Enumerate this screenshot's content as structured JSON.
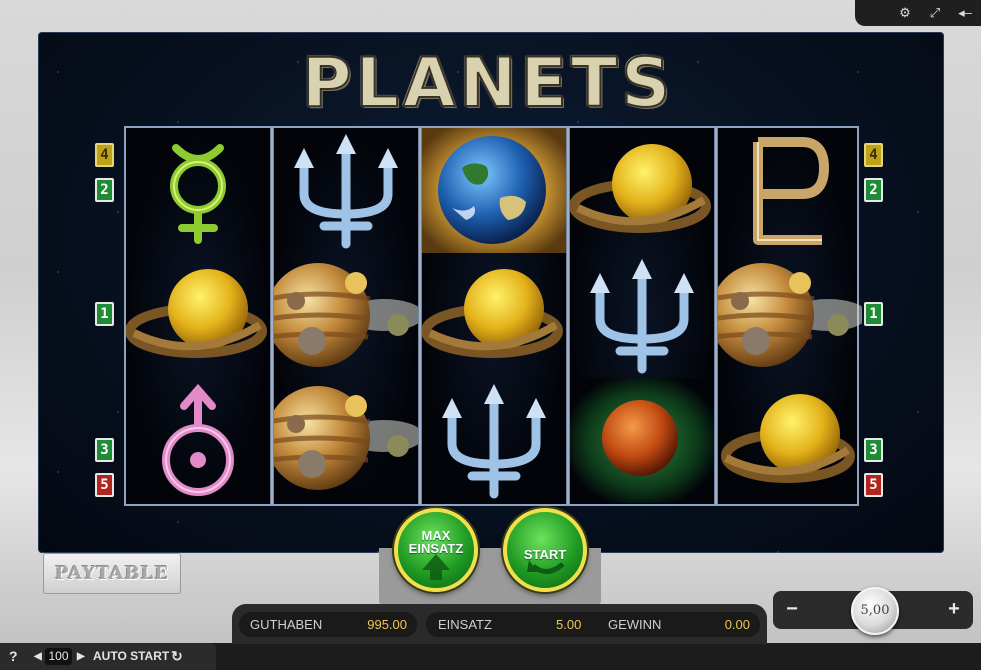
{
  "toolbar": {
    "settings_icon": "gear-icon",
    "fullscreen_icon": "fullscreen-icon",
    "sound_icon": "speaker-mute-icon"
  },
  "game": {
    "title": "PLANETS",
    "reels": [
      [
        "mercury-symbol",
        "saturn",
        "uranus-symbol"
      ],
      [
        "neptune-trident",
        "jupiter-moons",
        "jupiter-moons"
      ],
      [
        "earth",
        "saturn",
        "neptune-trident"
      ],
      [
        "saturn",
        "neptune-trident",
        "mars"
      ],
      [
        "pluto-symbol",
        "jupiter-moons",
        "saturn"
      ]
    ],
    "left_lines": [
      {
        "label": "4",
        "color": "yellow"
      },
      {
        "label": "2",
        "color": "green"
      },
      {
        "label": "1",
        "color": "green"
      },
      {
        "label": "3",
        "color": "green"
      },
      {
        "label": "5",
        "color": "red"
      }
    ],
    "right_lines": [
      {
        "label": "4",
        "color": "yellow"
      },
      {
        "label": "2",
        "color": "green"
      },
      {
        "label": "1",
        "color": "green"
      },
      {
        "label": "3",
        "color": "green"
      },
      {
        "label": "5",
        "color": "red"
      }
    ]
  },
  "buttons": {
    "max_bet_line1": "MAX",
    "max_bet_line2": "EINSATZ",
    "start": "START",
    "paytable": "PAYTABLE"
  },
  "status": {
    "balance_label": "GUTHABEN",
    "balance_value": "995.00",
    "bet_label": "EINSATZ",
    "bet_value": "5.00",
    "win_label": "GEWINN",
    "win_value": "0.00"
  },
  "controls": {
    "help": "?",
    "autostart_count": "100",
    "autostart_label": "AUTO START"
  },
  "stake": {
    "minus": "−",
    "plus": "+",
    "coin_value": "5,00"
  },
  "colors": {
    "line_yellow": "#bfa219",
    "line_green": "#1e8b35",
    "line_red": "#b2241e",
    "value_gold": "#f0c64c"
  }
}
